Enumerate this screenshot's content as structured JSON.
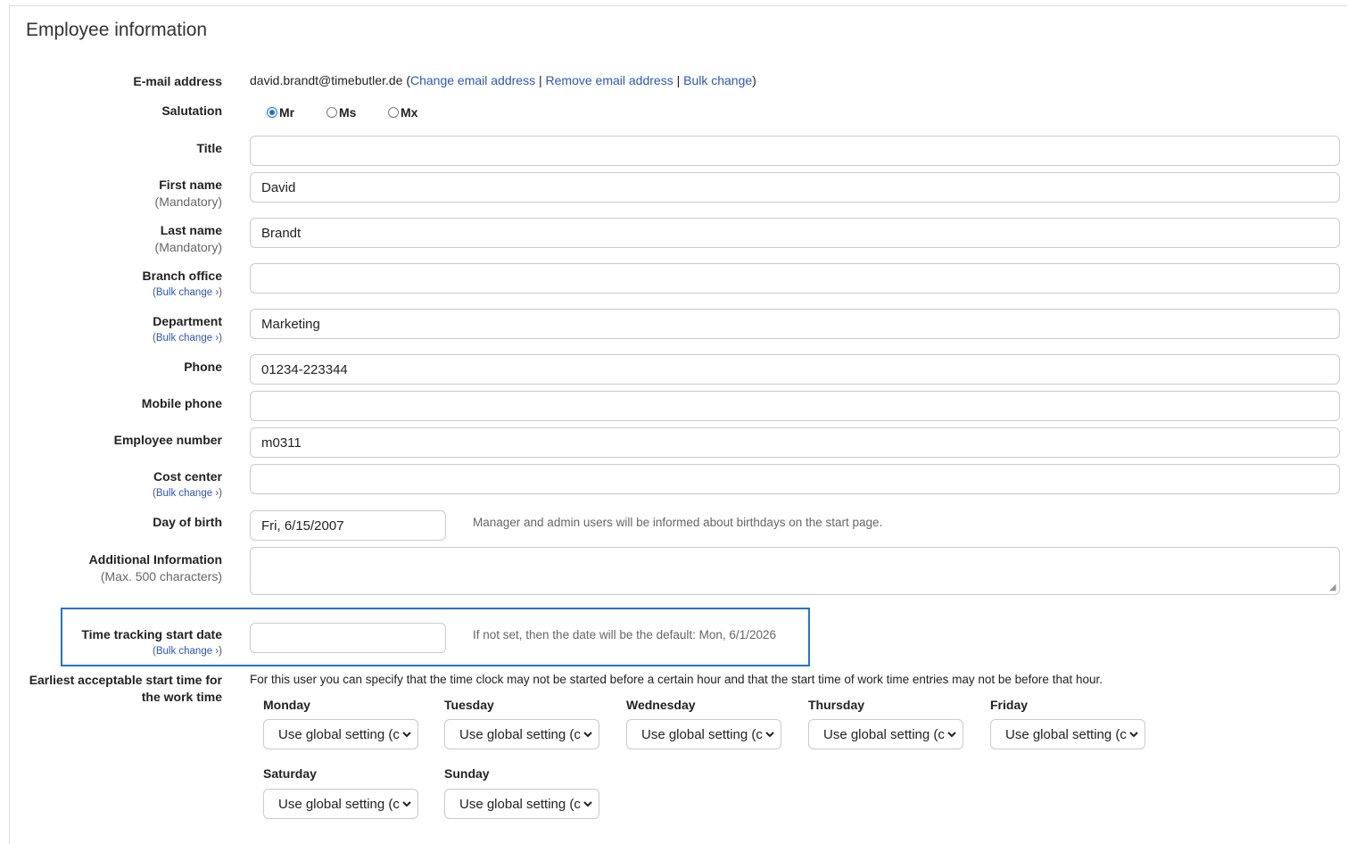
{
  "title": "Employee information",
  "email": {
    "label": "E-mail address",
    "value": "david.brandt@timebutler.de",
    "open_paren": "(",
    "change_link": "Change email address",
    "sep1": "|",
    "remove_link": "Remove email address",
    "sep2": "|",
    "bulk_link": "Bulk change",
    "close_paren": ")"
  },
  "salutation": {
    "label": "Salutation",
    "options": [
      "Mr",
      "Ms",
      "Mx"
    ],
    "selected": "Mr"
  },
  "fields": {
    "title": {
      "label": "Title",
      "value": ""
    },
    "first_name": {
      "label": "First name",
      "sub": "(Mandatory)",
      "value": "David"
    },
    "last_name": {
      "label": "Last name",
      "sub": "(Mandatory)",
      "value": "Brandt"
    },
    "branch_office": {
      "label": "Branch office",
      "value": ""
    },
    "department": {
      "label": "Department",
      "value": "Marketing"
    },
    "phone": {
      "label": "Phone",
      "value": "01234-223344"
    },
    "mobile_phone": {
      "label": "Mobile phone",
      "value": ""
    },
    "employee_number": {
      "label": "Employee number",
      "value": "m0311"
    },
    "cost_center": {
      "label": "Cost center",
      "value": ""
    },
    "day_of_birth": {
      "label": "Day of birth",
      "value": "Fri, 6/15/2007",
      "hint": "Manager and admin users will be informed about birthdays on the start page."
    },
    "additional_info": {
      "label": "Additional Information",
      "sub": "(Max. 500 characters)",
      "value": ""
    },
    "time_tracking_start": {
      "label": "Time tracking start date",
      "value": "",
      "hint": "If not set, then the date will be the default: Mon, 6/1/2026"
    }
  },
  "bulk_change": {
    "open": "(",
    "link": "Bulk change ›",
    "close": ")"
  },
  "earliest_start": {
    "label_line1": "Earliest acceptable start time for",
    "label_line2": "the work time",
    "description": "For this user you can specify that the time clock may not be started before a certain hour and that the start time of work time entries may not be before that hour.",
    "days": [
      {
        "day": "Monday",
        "value": "Use global setting (c"
      },
      {
        "day": "Tuesday",
        "value": "Use global setting (c"
      },
      {
        "day": "Wednesday",
        "value": "Use global setting (c"
      },
      {
        "day": "Thursday",
        "value": "Use global setting (c"
      },
      {
        "day": "Friday",
        "value": "Use global setting (c"
      },
      {
        "day": "Saturday",
        "value": "Use global setting (c"
      },
      {
        "day": "Sunday",
        "value": "Use global setting (c"
      }
    ]
  },
  "colors": {
    "link": "#2a56b8",
    "highlight": "#1e74d8",
    "radio": "#1a6fe0"
  }
}
